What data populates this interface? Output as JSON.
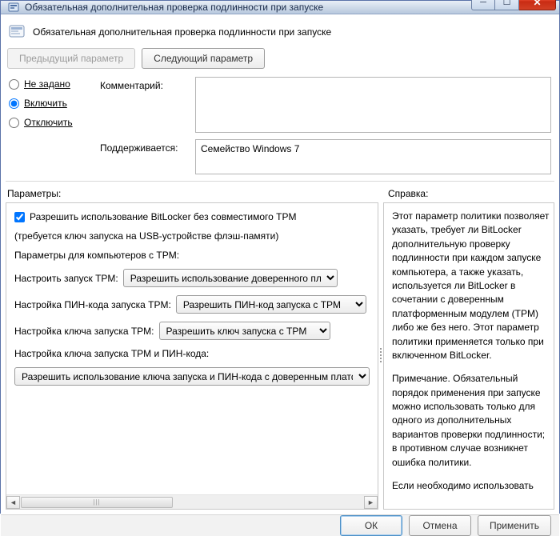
{
  "window": {
    "title": "Обязательная дополнительная проверка подлинности при запуске"
  },
  "header": {
    "title": "Обязательная дополнительная проверка подлинности при запуске"
  },
  "nav": {
    "prev": "Предыдущий параметр",
    "next": "Следующий параметр"
  },
  "state": {
    "not_configured": "Не задано",
    "enabled": "Включить",
    "disabled": "Отключить",
    "selected": "enabled"
  },
  "labels": {
    "comment": "Комментарий:",
    "supported": "Поддерживается:",
    "parameters": "Параметры:",
    "help": "Справка:"
  },
  "supported_text": "Семейство Windows 7",
  "params": {
    "allow_without_tpm_label": "Разрешить использование BitLocker без совместимого TPM",
    "allow_without_tpm_checked": true,
    "usb_note": "(требуется ключ запуска на USB-устройстве флэш-памяти)",
    "tpm_header": "Параметры для компьютеров с TPM:",
    "tpm_startup_label": "Настроить запуск TPM:",
    "tpm_startup_value": "Разрешить использование доверенного платформенного модуля",
    "tpm_pin_label": "Настройка ПИН-кода запуска TPM:",
    "tpm_pin_value": "Разрешить ПИН-код запуска с TPM",
    "tpm_key_label": "Настройка ключа запуска TPM:",
    "tpm_key_value": "Разрешить ключ запуска с TPM",
    "tpm_key_pin_label": "Настройка ключа запуска TPM и ПИН-кода:",
    "tpm_key_pin_value": "Разрешить использование ключа запуска и ПИН-кода с доверенным платформенным модулем"
  },
  "help": {
    "p1": "Этот параметр политики позволяет указать, требует ли BitLocker дополнительную проверку подлинности при каждом запуске компьютера, а также указать, используется ли BitLocker в сочетании с доверенным платформенным модулем (TPM) либо же без него. Этот параметр политики применяется только при включенном BitLocker.",
    "p2": "Примечание. Обязательный порядок применения при запуске можно использовать только для одного из дополнительных вариантов проверки подлинности; в противном случае возникнет ошибка политики.",
    "p3": "Если необходимо использовать"
  },
  "footer": {
    "ok": "ОК",
    "cancel": "Отмена",
    "apply": "Применить"
  }
}
